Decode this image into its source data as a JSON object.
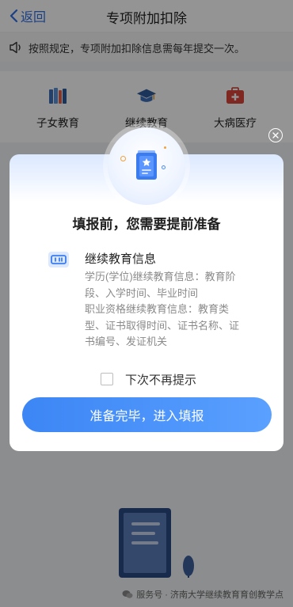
{
  "nav": {
    "back_label": "返回",
    "title": "专项附加扣除"
  },
  "notice": {
    "text": "按照规定，专项附加扣除信息需每年提交一次。"
  },
  "categories": [
    {
      "label": "子女教育",
      "icon": "books-icon"
    },
    {
      "label": "继续教育",
      "icon": "graduation-cap-icon"
    },
    {
      "label": "大病医疗",
      "icon": "medical-kit-icon"
    }
  ],
  "modal": {
    "title": "填报前，您需要提前准备",
    "info_title": "继续教育信息",
    "info_lines": [
      "学历(学位)继续教育信息：教育阶段、入学时间、毕业时间",
      "职业资格继续教育信息：教育类型、证书取得时间、证书名称、证书编号、发证机关"
    ],
    "checkbox_label": "下次不再提示",
    "confirm_label": "准备完毕，进入填报",
    "close_icon": "close-icon"
  },
  "footer": {
    "text": "服务号 · 济南大学继续教育育创教学点"
  },
  "colors": {
    "accent": "#3c86f5",
    "title": "#1f1f1f",
    "muted": "#8a8a8a"
  }
}
